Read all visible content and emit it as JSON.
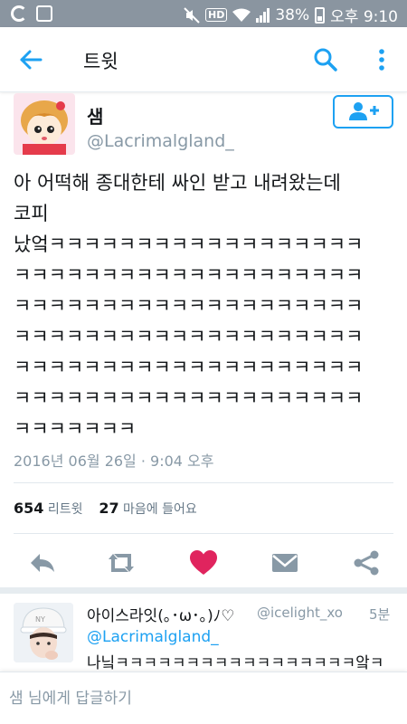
{
  "status_bar": {
    "battery": "38%",
    "time": "오후 9:10",
    "hd_label": "HD"
  },
  "app_bar": {
    "title": "트윗"
  },
  "tweet": {
    "author_name": "샘",
    "handle": "@Lacrimalgland_",
    "text": "아 어떡해 종대한테 싸인 받고 내려왔는데\n코피\n났엌ㅋㅋㅋㅋㅋㅋㅋㅋㅋㅋㅋㅋㅋㅋㅋㅋㅋㅋ\nㅋㅋㅋㅋㅋㅋㅋㅋㅋㅋㅋㅋㅋㅋㅋㅋㅋㅋㅋㅋ\nㅋㅋㅋㅋㅋㅋㅋㅋㅋㅋㅋㅋㅋㅋㅋㅋㅋㅋㅋㅋ\nㅋㅋㅋㅋㅋㅋㅋㅋㅋㅋㅋㅋㅋㅋㅋㅋㅋㅋㅋㅋ\nㅋㅋㅋㅋㅋㅋㅋㅋㅋㅋㅋㅋㅋㅋㅋㅋㅋㅋㅋㅋ\nㅋㅋㅋㅋㅋㅋㅋㅋㅋㅋㅋㅋㅋㅋㅋㅋㅋㅋㅋㅋ\nㅋㅋㅋㅋㅋㅋㅋ",
    "timestamp": "2016년 06월 26일 · 9:04 오후",
    "retweet_count": "654",
    "retweet_label": "리트윗",
    "like_count": "27",
    "like_label": "마음에 들어요"
  },
  "colors": {
    "accent": "#1da1f2",
    "like": "#e0245e",
    "muted": "#8899a6",
    "status_bar": "#8a95a0"
  },
  "icons": {
    "back": "arrow-left-icon",
    "search": "search-icon",
    "more": "more-vertical-icon",
    "follow": "add-user-icon",
    "reply": "reply-icon",
    "retweet": "retweet-icon",
    "like": "heart-icon",
    "dm": "envelope-icon",
    "share": "share-icon"
  },
  "reply": {
    "name": "아이스라잇(｡･ω･｡)ﾉ♡",
    "handle": "@icelight_xo",
    "time": "5분",
    "mention": "@Lacrimalgland_",
    "text": "나닠ㅋㅋㅋㅋㅋㅋㅋㅋㅋㅋㅋㅋㅋㅋㅋㅋㅋ앜ㅋ"
  },
  "composer": {
    "placeholder": "샘 님에게 답글하기"
  }
}
